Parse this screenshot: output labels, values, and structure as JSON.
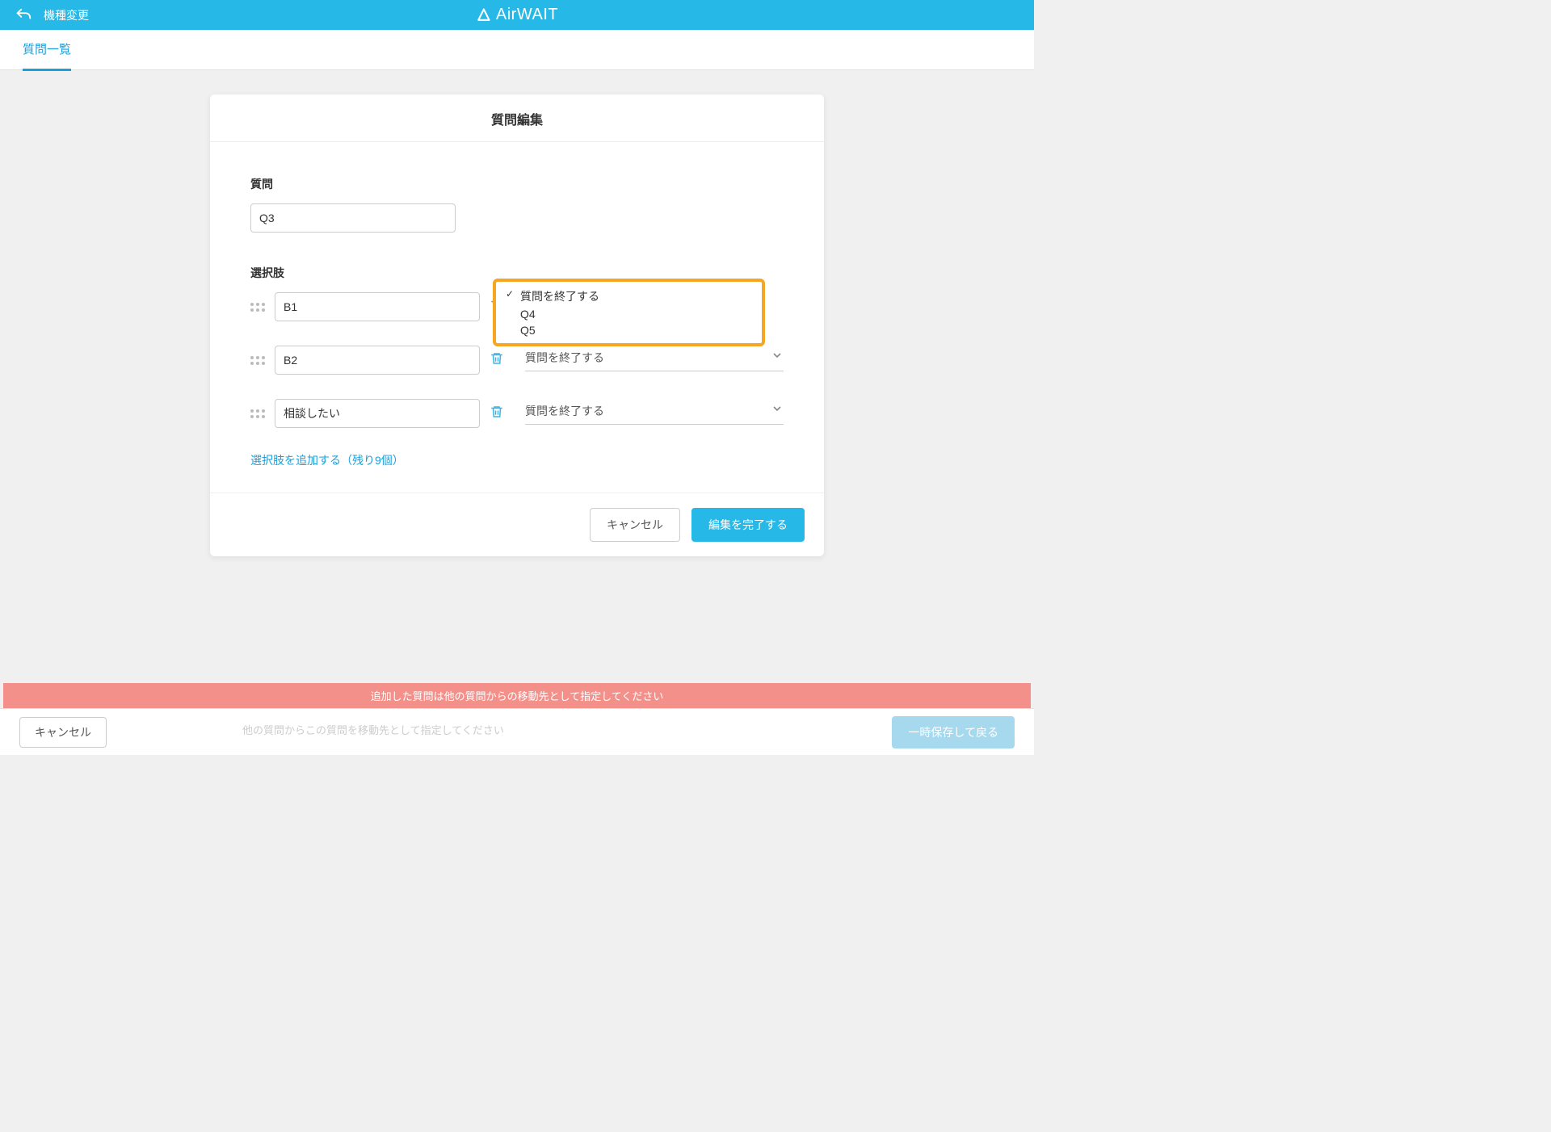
{
  "header": {
    "back_label": "機種変更",
    "brand": "AirWAIT"
  },
  "subheader": {
    "tab": "質問一覧"
  },
  "modal": {
    "title": "質問編集",
    "question_label": "質問",
    "question_value": "Q3",
    "choices_label": "選択肢",
    "choices": [
      {
        "value": "B1",
        "dest": "質問を終了する"
      },
      {
        "value": "B2",
        "dest": "質問を終了する"
      },
      {
        "value": "相談したい",
        "dest": "質問を終了する"
      }
    ],
    "dropdown_options": [
      {
        "label": "質問を終了する",
        "checked": true
      },
      {
        "label": "Q4",
        "checked": false
      },
      {
        "label": "Q5",
        "checked": false
      }
    ],
    "add_choice_label": "選択肢を追加する（残り9個）",
    "footer": {
      "cancel": "キャンセル",
      "submit": "編集を完了する"
    }
  },
  "alert": "追加した質問は他の質問からの移動先として指定してください",
  "bottom": {
    "cancel": "キャンセル",
    "placeholder": "他の質問からこの質問を移動先として指定してください",
    "save": "一時保存して戻る"
  }
}
